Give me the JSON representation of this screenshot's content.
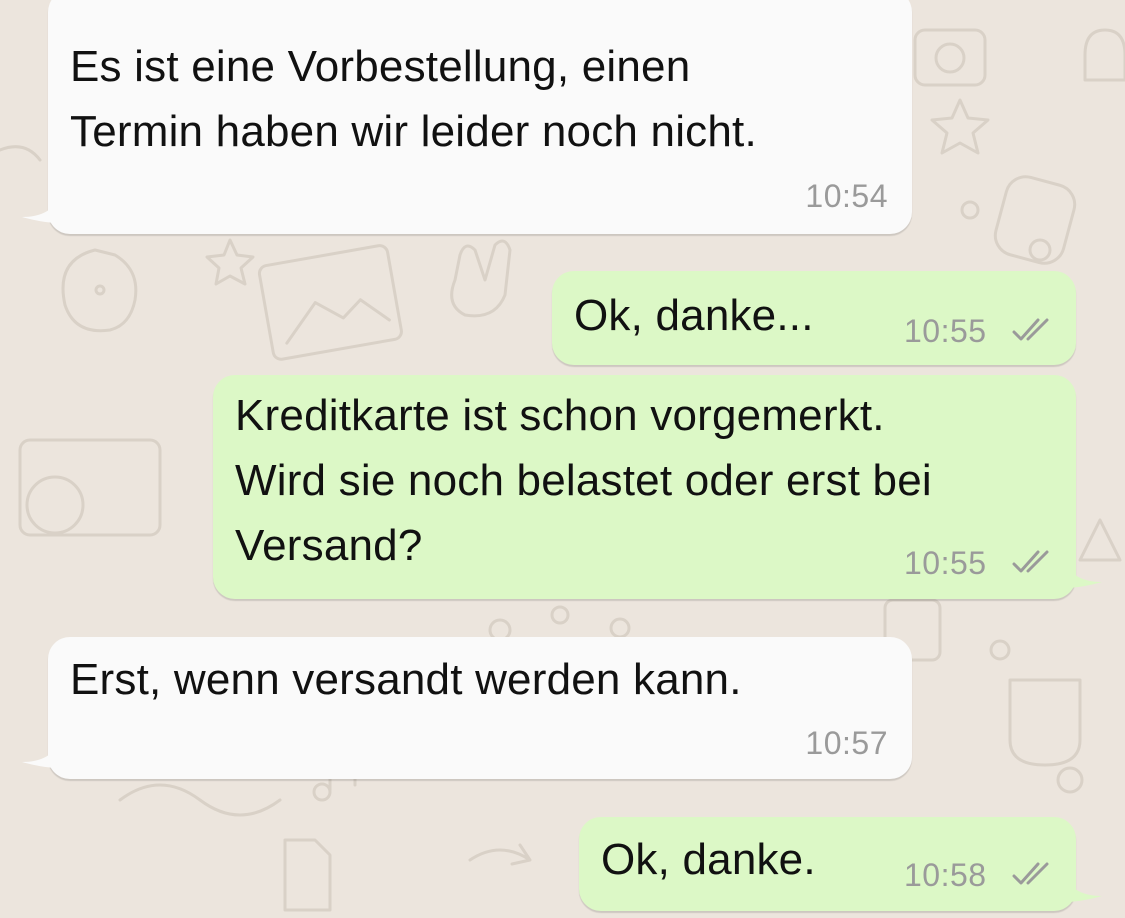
{
  "colors": {
    "background": "#ece5dd",
    "incoming_bubble": "#fafafa",
    "outgoing_bubble": "#dcf8c6",
    "timestamp": "#9a9a9a",
    "read_receipt": "#9a9a9a"
  },
  "messages": [
    {
      "direction": "incoming",
      "text": "Es ist eine Vorbestellung, einen\nTermin haben wir leider noch nicht.",
      "time": "10:54"
    },
    {
      "direction": "outgoing",
      "text": "Ok, danke...",
      "time": "10:55",
      "status_icon": "double-check-icon"
    },
    {
      "direction": "outgoing",
      "text": "Kreditkarte ist schon vorgemerkt.\nWird sie noch belastet oder erst bei\nVersand?",
      "time": "10:55",
      "status_icon": "double-check-icon"
    },
    {
      "direction": "incoming",
      "text": "Erst, wenn versandt werden kann.",
      "time": "10:57"
    },
    {
      "direction": "outgoing",
      "text": "Ok, danke.",
      "time": "10:58",
      "status_icon": "double-check-icon"
    }
  ]
}
